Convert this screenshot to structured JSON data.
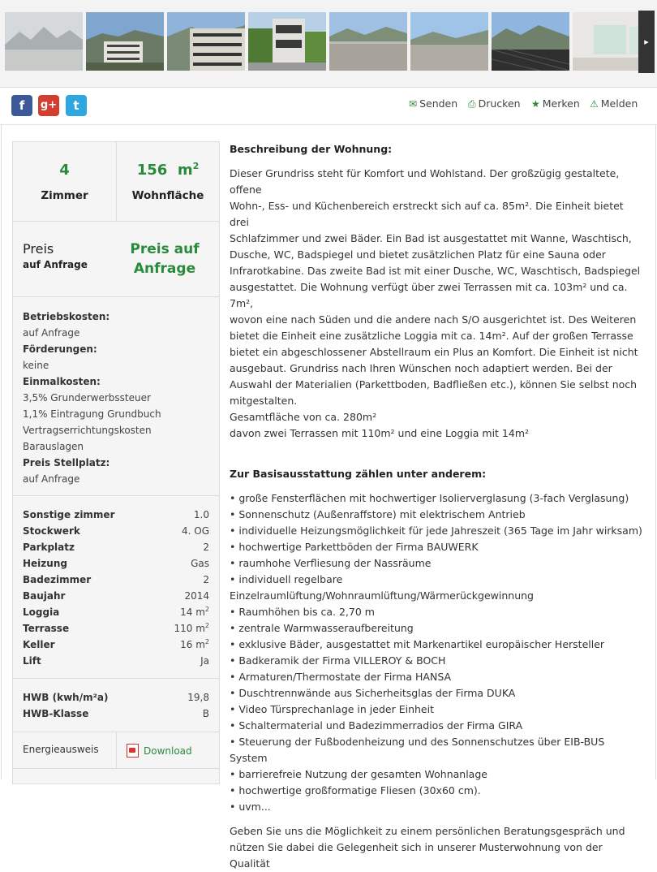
{
  "gallery": {
    "next_arrow": "▸",
    "thumbs": [
      "mountain-view-icon",
      "building-exterior-icon",
      "building-balcony-icon",
      "building-street-icon",
      "terrace-icon",
      "terrace-wide-icon",
      "balcony-view-icon",
      "interior-room-icon"
    ]
  },
  "toolbar": {
    "social": {
      "facebook": "f",
      "googleplus": "g+",
      "twitter": "t"
    },
    "send": "Senden",
    "print": "Drucken",
    "bookmark": "Merken",
    "report": "Melden"
  },
  "sidebar": {
    "rooms_value": "4",
    "rooms_label": "Zimmer",
    "area_value": "156",
    "area_unit": "m",
    "area_sup": "2",
    "area_label": "Wohnfläche",
    "price_label": "Preis",
    "price_sub": "auf Anfrage",
    "price_value": "Preis auf Anfrage",
    "costs": [
      {
        "k": "Betriebskosten:",
        "v": [
          "auf Anfrage"
        ]
      },
      {
        "k": "Förderungen:",
        "v": [
          "keine"
        ]
      },
      {
        "k": "Einmalkosten:",
        "v": [
          "3,5% Grunderwerbssteuer",
          "1,1% Eintragung Grundbuch",
          "Vertragserrichtungskosten",
          "Barauslagen"
        ]
      },
      {
        "k": "Preis Stellplatz:",
        "v": [
          "auf Anfrage"
        ]
      }
    ],
    "facts": [
      {
        "k": "Sonstige zimmer",
        "v": "1.0"
      },
      {
        "k": "Stockwerk",
        "v": "4. OG"
      },
      {
        "k": "Parkplatz",
        "v": "2"
      },
      {
        "k": "Heizung",
        "v": "Gas"
      },
      {
        "k": "Badezimmer",
        "v": "2"
      },
      {
        "k": "Baujahr",
        "v": "2014"
      },
      {
        "k": "Loggia",
        "v": "14 m",
        "sup": "2"
      },
      {
        "k": "Terrasse",
        "v": "110 m",
        "sup": "2"
      },
      {
        "k": "Keller",
        "v": "16 m",
        "sup": "2"
      },
      {
        "k": "Lift",
        "v": "Ja"
      }
    ],
    "hwb": [
      {
        "k": "HWB (kwh/m²a)",
        "v": "19,8"
      },
      {
        "k": "HWB-Klasse",
        "v": "B"
      }
    ],
    "energy_label": "Energieausweis",
    "download": "Download"
  },
  "main": {
    "desc_heading": "Beschreibung der Wohnung:",
    "desc_lines": [
      "Dieser Grundriss steht für Komfort und Wohlstand. Der großzügig gestaltete, offene",
      "Wohn-, Ess- und Küchenbereich erstreckt sich auf ca. 85m². Die Einheit bietet drei",
      "Schlafzimmer und zwei Bäder. Ein Bad ist ausgestattet mit Wanne, Waschtisch,",
      "Dusche, WC, Badspiegel und bietet zusätzlichen Platz für eine Sauna oder",
      "Infrarotkabine. Das zweite Bad ist mit einer Dusche, WC, Waschtisch, Badspiegel",
      "ausgestattet. Die Wohnung verfügt über zwei Terrassen mit ca. 103m² und ca. 7m²,",
      "wovon eine nach Süden und die andere nach S/O ausgerichtet ist. Des Weiteren",
      "bietet die Einheit eine zusätzliche Loggia mit ca. 14m². Auf der großen Terrasse",
      "bietet ein abgeschlossener Abstellraum ein Plus an Komfort. Die Einheit ist nicht",
      "ausgebaut. Grundriss nach Ihren Wünschen noch adaptiert werden. Bei der",
      "Auswahl der Materialien (Parkettboden, Badfließen etc.), können Sie selbst noch",
      "mitgestalten.",
      "Gesamtfläche von ca. 280m²",
      "davon zwei Terrassen mit 110m² und eine Loggia mit 14m²"
    ],
    "basis_heading": "Zur Basisausstattung zählen unter anderem:",
    "basis_items": [
      "• große Fensterflächen mit hochwertiger Isolierverglasung (3-fach Verglasung)",
      "• Sonnenschutz (Außenraffstore) mit elektrischem Antrieb",
      "• individuelle Heizungsmöglichkeit für jede Jahreszeit (365 Tage im Jahr wirksam)",
      "• hochwertige Parkettböden der Firma BAUWERK",
      "• raumhohe Verfliesung der Nassräume",
      "• individuell regelbare Einzelraumlüftung/Wohnraumlüftung/Wärmerückgewinnung",
      "• Raumhöhen bis ca. 2,70 m",
      "• zentrale Warmwasseraufbereitung",
      "• exklusive Bäder, ausgestattet mit Markenartikel europäischer Hersteller",
      "• Badkeramik der Firma VILLEROY & BOCH",
      "• Armaturen/Thermostate der Firma HANSA",
      "• Duschtrennwände aus Sicherheitsglas der Firma DUKA",
      "• Video Türsprechanlage in jeder Einheit",
      "• Schaltermaterial und Badezimmerradios der Firma GIRA",
      "• Steuerung der Fußbodenheizung und des Sonnenschutzes über EIB-BUS System",
      "• barrierefreie Nutzung der gesamten Wohnanlage",
      "• hochwertige großformatige Fliesen (30x60 cm).",
      "• uvm..."
    ],
    "closing_lines": [
      "Geben Sie uns die Möglichkeit zu einem persönlichen Beratungsgespräch und",
      "nützen Sie dabei die Gelegenheit sich in unserer Musterwohnung von der Qualität"
    ]
  }
}
